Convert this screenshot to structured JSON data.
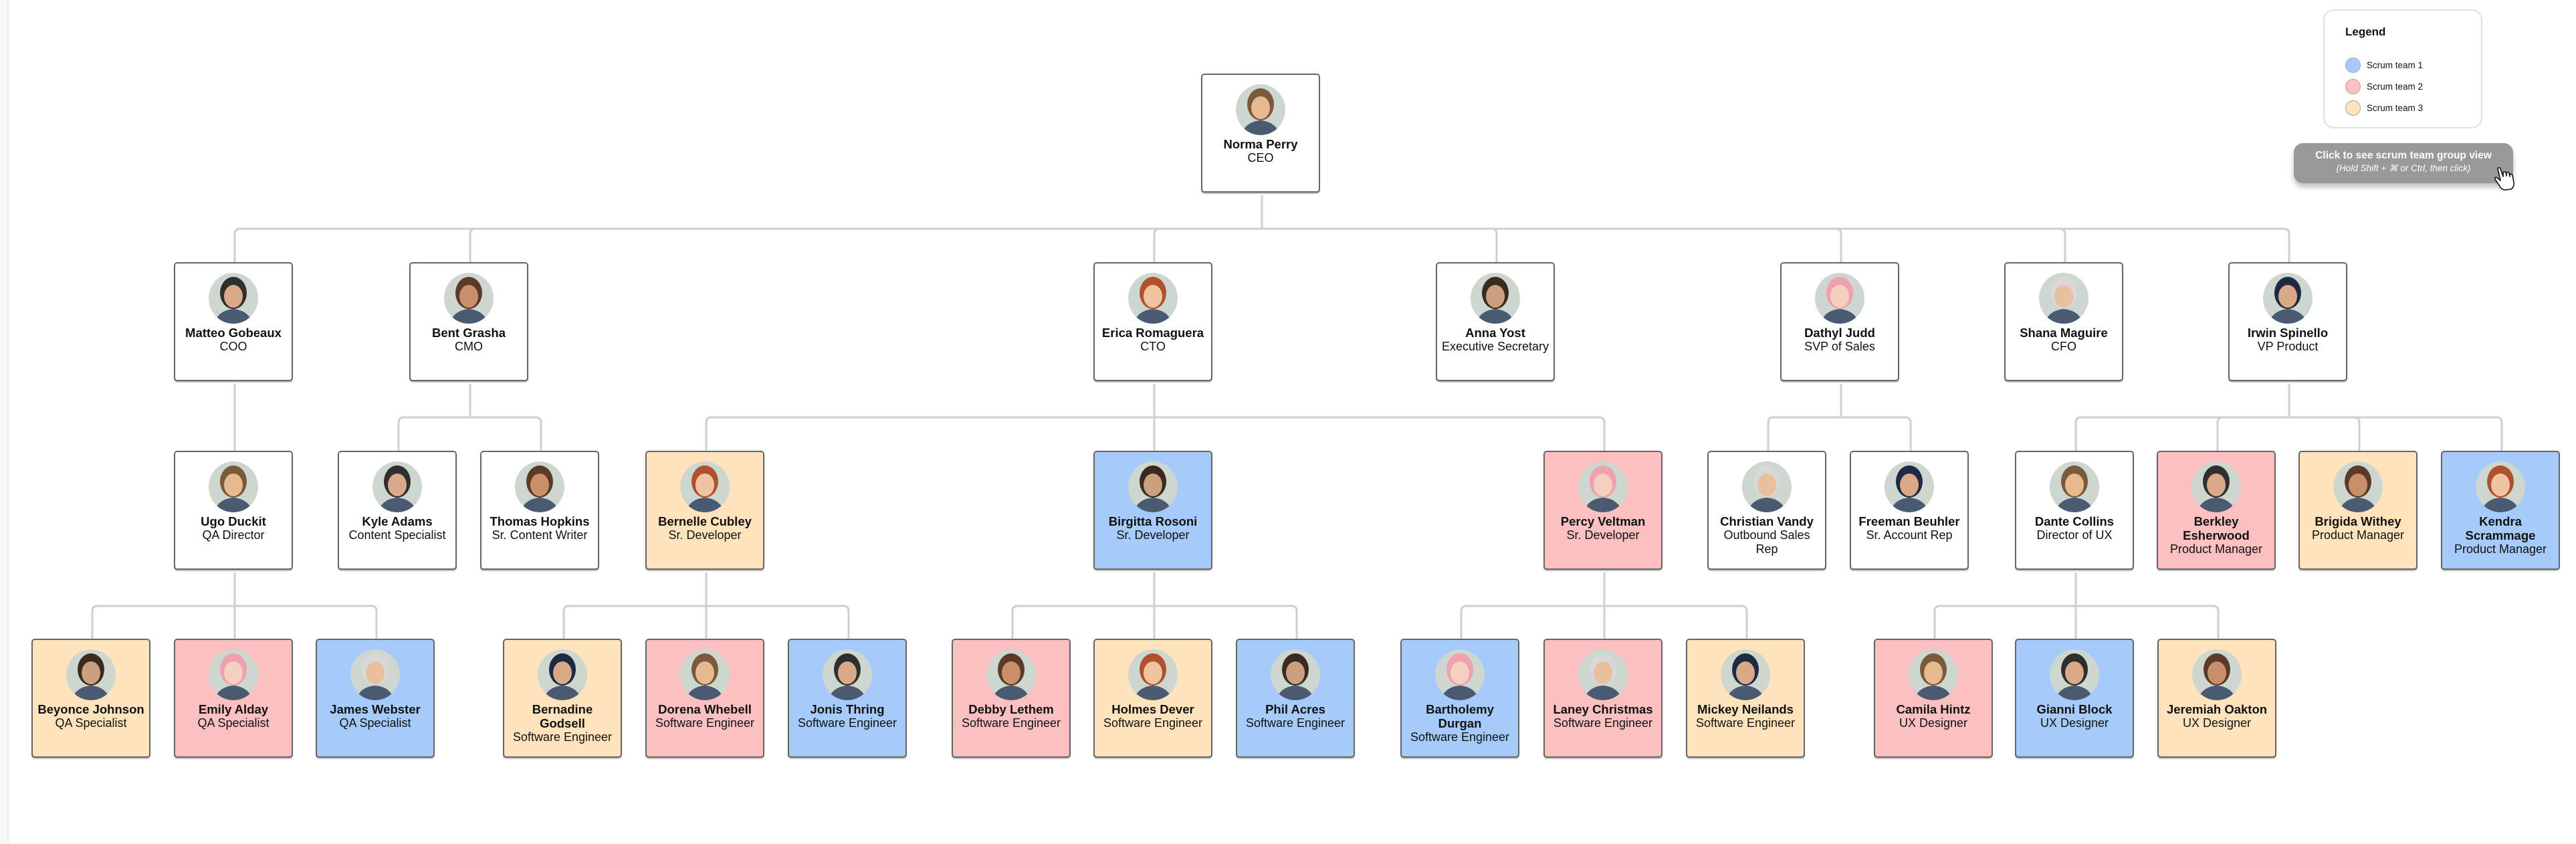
{
  "legend": {
    "title": "Legend",
    "items": [
      {
        "label": "Scrum team 1",
        "color": "#a6cbfa"
      },
      {
        "label": "Scrum team 2",
        "color": "#fdc0c0"
      },
      {
        "label": "Scrum team 3",
        "color": "#ffe3bc"
      }
    ]
  },
  "cta": {
    "title": "Click to see scrum team group view",
    "subtitle": "(Hold Shift + ⌘ or Ctrl, then click)",
    "icon": "pointer-hand-icon"
  },
  "colors": {
    "white": "#ffffff",
    "team1": "#a6cbfa",
    "team2": "#fdc0c0",
    "team3": "#ffe3bc",
    "border": "#666666",
    "connector": "#cfcfcf"
  },
  "people": [
    {
      "id": "norma",
      "name": "Norma Perry",
      "role": "CEO",
      "team": "white",
      "manager": null
    },
    {
      "id": "matteo",
      "name": "Matteo Gobeaux",
      "role": "COO",
      "team": "white",
      "manager": "norma"
    },
    {
      "id": "bent",
      "name": "Bent Grasha",
      "role": "CMO",
      "team": "white",
      "manager": "norma"
    },
    {
      "id": "erica",
      "name": "Erica Romaguera",
      "role": "CTO",
      "team": "white",
      "manager": "norma"
    },
    {
      "id": "anna",
      "name": "Anna Yost",
      "role": "Executive Secretary",
      "team": "white",
      "manager": "norma"
    },
    {
      "id": "dathyl",
      "name": "Dathyl Judd",
      "role": "SVP of Sales",
      "team": "white",
      "manager": "norma"
    },
    {
      "id": "shana",
      "name": "Shana Maguire",
      "role": "CFO",
      "team": "white",
      "manager": "norma"
    },
    {
      "id": "irwin",
      "name": "Irwin Spinello",
      "role": "VP Product",
      "team": "white",
      "manager": "norma"
    },
    {
      "id": "ugo",
      "name": "Ugo Duckit",
      "role": "QA Director",
      "team": "white",
      "manager": "matteo"
    },
    {
      "id": "kyle",
      "name": "Kyle Adams",
      "role": "Content Specialist",
      "team": "white",
      "manager": "bent"
    },
    {
      "id": "thomas",
      "name": "Thomas Hopkins",
      "role": "Sr. Content Writer",
      "team": "white",
      "manager": "bent"
    },
    {
      "id": "bernelle",
      "name": "Bernelle Cubley",
      "role": "Sr. Developer",
      "team": "team3",
      "manager": "erica"
    },
    {
      "id": "birgitta",
      "name": "Birgitta Rosoni",
      "role": "Sr. Developer",
      "team": "team1",
      "manager": "erica"
    },
    {
      "id": "percy",
      "name": "Percy Veltman",
      "role": "Sr. Developer",
      "team": "team2",
      "manager": "erica"
    },
    {
      "id": "christian",
      "name": "Christian Vandy",
      "role": "Outbound Sales Rep",
      "team": "white",
      "manager": "dathyl"
    },
    {
      "id": "freeman",
      "name": "Freeman Beuhler",
      "role": "Sr. Account Rep",
      "team": "white",
      "manager": "dathyl"
    },
    {
      "id": "dante",
      "name": "Dante Collins",
      "role": "Director of UX",
      "team": "white",
      "manager": "irwin"
    },
    {
      "id": "berkley",
      "name": "Berkley Esherwood",
      "role": "Product Manager",
      "team": "team2",
      "manager": "irwin"
    },
    {
      "id": "brigida",
      "name": "Brigida Withey",
      "role": "Product Manager",
      "team": "team3",
      "manager": "irwin"
    },
    {
      "id": "kendra",
      "name": "Kendra Scrammage",
      "role": "Product Manager",
      "team": "team1",
      "manager": "irwin"
    },
    {
      "id": "beyonce",
      "name": "Beyonce Johnson",
      "role": "QA Specialist",
      "team": "team3",
      "manager": "ugo"
    },
    {
      "id": "emily",
      "name": "Emily Alday",
      "role": "QA Specialist",
      "team": "team2",
      "manager": "ugo"
    },
    {
      "id": "james",
      "name": "James Webster",
      "role": "QA Specialist",
      "team": "team1",
      "manager": "ugo"
    },
    {
      "id": "bernadine",
      "name": "Bernadine Godsell",
      "role": "Software Engineer",
      "team": "team3",
      "manager": "bernelle"
    },
    {
      "id": "dorena",
      "name": "Dorena Whebell",
      "role": "Software Engineer",
      "team": "team2",
      "manager": "bernelle"
    },
    {
      "id": "jonis",
      "name": "Jonis Thring",
      "role": "Software Engineer",
      "team": "team1",
      "manager": "bernelle"
    },
    {
      "id": "debby",
      "name": "Debby Lethem",
      "role": "Software Engineer",
      "team": "team2",
      "manager": "birgitta"
    },
    {
      "id": "holmes",
      "name": "Holmes Dever",
      "role": "Software Engineer",
      "team": "team3",
      "manager": "birgitta"
    },
    {
      "id": "phil",
      "name": "Phil Acres",
      "role": "Software Engineer",
      "team": "team1",
      "manager": "birgitta"
    },
    {
      "id": "bartholemy",
      "name": "Bartholemy Durgan",
      "role": "Software Engineer",
      "team": "team1",
      "manager": "percy"
    },
    {
      "id": "laney",
      "name": "Laney Christmas",
      "role": "Software Engineer",
      "team": "team2",
      "manager": "percy"
    },
    {
      "id": "mickey",
      "name": "Mickey Neilands",
      "role": "Software Engineer",
      "team": "team3",
      "manager": "percy"
    },
    {
      "id": "camila",
      "name": "Camila Hintz",
      "role": "UX Designer",
      "team": "team2",
      "manager": "dante"
    },
    {
      "id": "gianni",
      "name": "Gianni Block",
      "role": "UX Designer",
      "team": "team1",
      "manager": "dante"
    },
    {
      "id": "jeremiah",
      "name": "Jeremiah Oakton",
      "role": "UX Designer",
      "team": "team3",
      "manager": "dante"
    }
  ]
}
